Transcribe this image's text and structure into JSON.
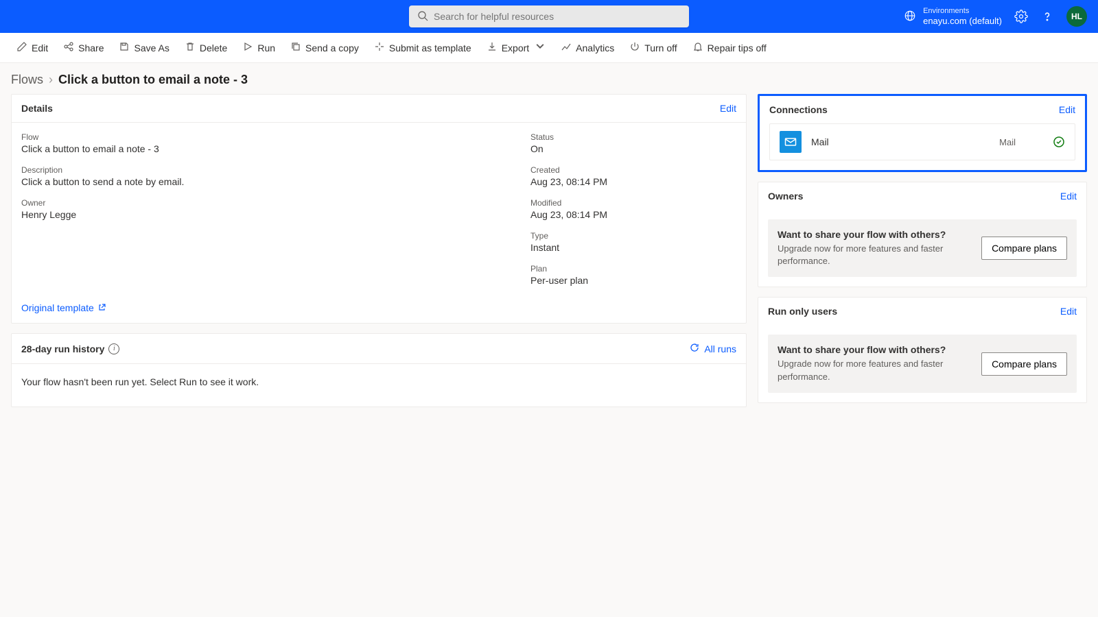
{
  "header": {
    "search_placeholder": "Search for helpful resources",
    "env_label": "Environments",
    "env_name": "enayu.com (default)",
    "avatar_initials": "HL"
  },
  "commands": {
    "edit": "Edit",
    "share": "Share",
    "save_as": "Save As",
    "delete": "Delete",
    "run": "Run",
    "send_copy": "Send a copy",
    "submit_template": "Submit as template",
    "export": "Export",
    "analytics": "Analytics",
    "turn_off": "Turn off",
    "repair_tips_off": "Repair tips off"
  },
  "breadcrumb": {
    "root": "Flows",
    "current": "Click a button to email a note - 3"
  },
  "details": {
    "heading": "Details",
    "edit": "Edit",
    "flow_label": "Flow",
    "flow_value": "Click a button to email a note - 3",
    "desc_label": "Description",
    "desc_value": "Click a button to send a note by email.",
    "owner_label": "Owner",
    "owner_value": "Henry Legge",
    "status_label": "Status",
    "status_value": "On",
    "created_label": "Created",
    "created_value": "Aug 23, 08:14 PM",
    "modified_label": "Modified",
    "modified_value": "Aug 23, 08:14 PM",
    "type_label": "Type",
    "type_value": "Instant",
    "plan_label": "Plan",
    "plan_value": "Per-user plan",
    "template_link": "Original template"
  },
  "runhistory": {
    "title": "28-day run history",
    "all_runs": "All runs",
    "empty": "Your flow hasn't been run yet. Select Run to see it work."
  },
  "connections": {
    "heading": "Connections",
    "edit": "Edit",
    "item_name": "Mail",
    "item_type": "Mail"
  },
  "owners": {
    "heading": "Owners",
    "edit": "Edit",
    "promo_title": "Want to share your flow with others?",
    "promo_sub": "Upgrade now for more features and faster performance.",
    "compare": "Compare plans"
  },
  "runonly": {
    "heading": "Run only users",
    "edit": "Edit",
    "promo_title": "Want to share your flow with others?",
    "promo_sub": "Upgrade now for more features and faster performance.",
    "compare": "Compare plans"
  }
}
